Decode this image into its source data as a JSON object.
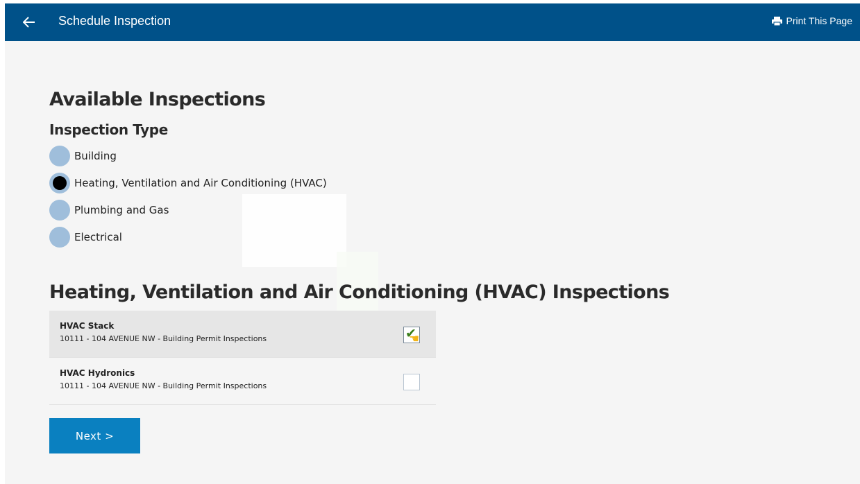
{
  "header": {
    "title": "Schedule Inspection",
    "print_label": "Print This Page"
  },
  "main": {
    "heading": "Available Inspections",
    "type_heading": "Inspection Type",
    "inspection_types": [
      {
        "label": "Building",
        "selected": false
      },
      {
        "label": "Heating, Ventilation and Air Conditioning (HVAC)",
        "selected": true
      },
      {
        "label": "Plumbing and Gas",
        "selected": false
      },
      {
        "label": "Electrical",
        "selected": false
      }
    ],
    "inspections_heading": "Heating, Ventilation and Air Conditioning (HVAC) Inspections",
    "inspections": [
      {
        "name": "HVAC Stack",
        "address": "10111 - 104 AVENUE NW - Building Permit Inspections",
        "checked": true
      },
      {
        "name": "HVAC Hydronics",
        "address": "10111 - 104 AVENUE NW - Building Permit Inspections",
        "checked": false
      }
    ],
    "next_label": "Next >"
  },
  "colors": {
    "header_bg": "#005189",
    "radio_unselected": "#9fbedb",
    "next_button": "#0a80c0",
    "page_bg": "#f5f5f5"
  },
  "icons": {
    "back": "arrow-left-icon",
    "print": "printer-icon",
    "check": "checkmark-icon",
    "cursor": "hand-pointer-icon"
  }
}
